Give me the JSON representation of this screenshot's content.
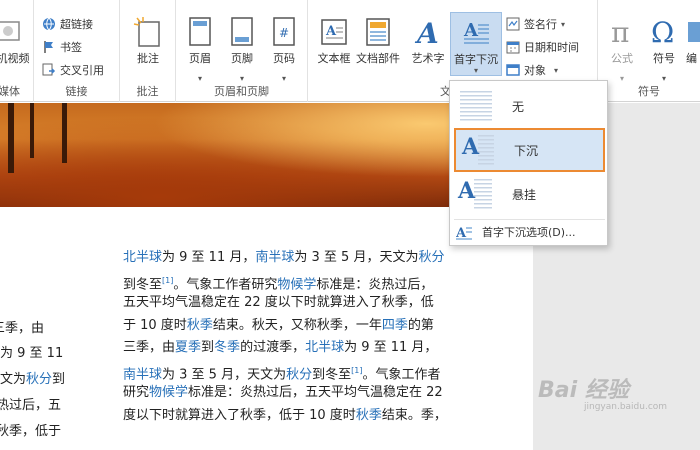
{
  "ribbon": {
    "groups": {
      "media": "媒体",
      "links": "链接",
      "comments": "批注",
      "header_footer": "页眉和页脚",
      "text": "文",
      "symbols": "符号"
    },
    "online_video": "机视频",
    "hyperlink": "超链接",
    "bookmark": "书签",
    "cross_reference": "交叉引用",
    "comment": "批注",
    "header": "页眉",
    "footer": "页脚",
    "page_number": "页码",
    "textbox": "文本框",
    "quick_parts": "文档部件",
    "wordart": "艺术字",
    "dropcap": "首字下沉",
    "signature_line": "签名行",
    "date_time": "日期和时间",
    "object": "对象",
    "equation": "公式",
    "symbol": "符号",
    "symbol_cut": "编"
  },
  "dropdown": {
    "items": [
      {
        "label": "无"
      },
      {
        "label": "下沉"
      },
      {
        "label": "悬挂"
      }
    ],
    "options_label": "首字下沉选项(D)...",
    "selected_border_color": "#ec8a32"
  },
  "document": {
    "p1": {
      "l1_a": "北半球",
      "l1_b": "为 9 至 11 月，",
      "l1_c": "南半球",
      "l1_d": "为 3 至 5 月，天文为",
      "l1_e": "秋分",
      "l2_a": "到冬至",
      "l2_sup": "[1]",
      "l2_b": "。气象工作者研究",
      "l2_c": "物候学",
      "l2_d": "标准是：炎热过后，",
      "l3": "五天平均气温稳定在 22 度以下时就算进入了秋季，低",
      "l4_a": "于 10 度时",
      "l4_b": "秋季",
      "l4_c": "结束。秋天，又称秋季，一年",
      "l4_d": "四季",
      "l4_e": "的第",
      "l5_a": "三季，由",
      "l5_b": "夏季",
      "l5_c": "到",
      "l5_d": "冬季",
      "l5_e": "的过渡季，",
      "l5_f": "北半球",
      "l5_g": "为 9 至 11 月，",
      "l6_a": "南半球",
      "l6_b": "为 3 至 5 月，天文为",
      "l6_c": "秋分",
      "l6_d": "到冬至",
      "l6_sup": "[1]",
      "l6_e": "。气象工作者",
      "l7_a": "研究",
      "l7_b": "物候学",
      "l7_c": "标准是：炎热过后，五天平均气温稳定在 22",
      "l8_a": "度以下时就算进入了秋季，低于 10 度时",
      "l8_b": "秋季",
      "l8_c": "结束。季，"
    },
    "left_col": {
      "l1": "三季，由",
      "l2": "为 9 至 11",
      "l3_a": "文为",
      "l3_b": "秋分",
      "l3_c": "到",
      "l4": "热过后，五",
      "l5": "秋季，低于"
    }
  },
  "watermark": {
    "text": "Bai 经验",
    "sub": "jingyan.baidu.com"
  },
  "colors": {
    "link": "#2770b8",
    "ribbon_icon_blue": "#2f6bb0",
    "selected_bg": "#d6e5f5"
  }
}
